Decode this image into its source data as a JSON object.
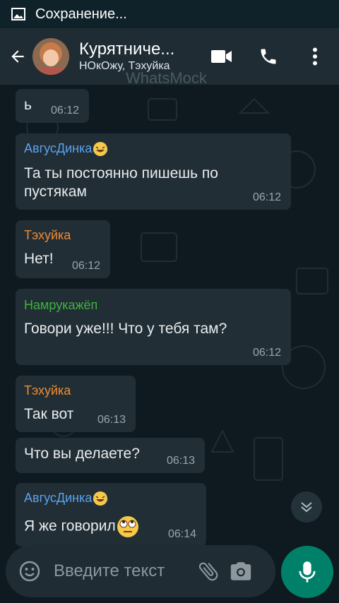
{
  "status_bar": {
    "text": "Сохранение..."
  },
  "header": {
    "title": "Курятниче...",
    "subtitle": "НОкОжу, Тэхуйка",
    "watermark": "WhatsMock"
  },
  "messages": [
    {
      "sender": "",
      "text": "ь",
      "time": "06:12"
    },
    {
      "sender": "АвгусДинка",
      "sender_emoji": "laughing-tears",
      "text": "Та ты постоянно пишешь по пустякам",
      "time": "06:12"
    },
    {
      "sender": "Тэхуйка",
      "text": "Нет!",
      "time": "06:12"
    },
    {
      "sender": "Намрукажёп",
      "text": "Говори уже!!! Что у тебя там?",
      "time": "06:12"
    },
    {
      "sender": "Тэхуйка",
      "text": "Так вот",
      "time": "06:13"
    },
    {
      "sender": "",
      "text": "Что вы делаете?",
      "time": "06:13"
    },
    {
      "sender": "АвгусДинка",
      "sender_emoji": "laughing-tears",
      "text": "Я же говорил",
      "text_emoji": "eye-roll",
      "time": "06:14"
    }
  ],
  "sender_colors": {
    "АвгусДинка": "#5aa2f0",
    "Тэхуйка": "#ef8b34",
    "Намрукажёп": "#3fb13f"
  },
  "composer": {
    "placeholder": "Введите текст"
  },
  "colors": {
    "accent": "#008069",
    "bubble": "#222e35",
    "header": "#1f2c33"
  }
}
